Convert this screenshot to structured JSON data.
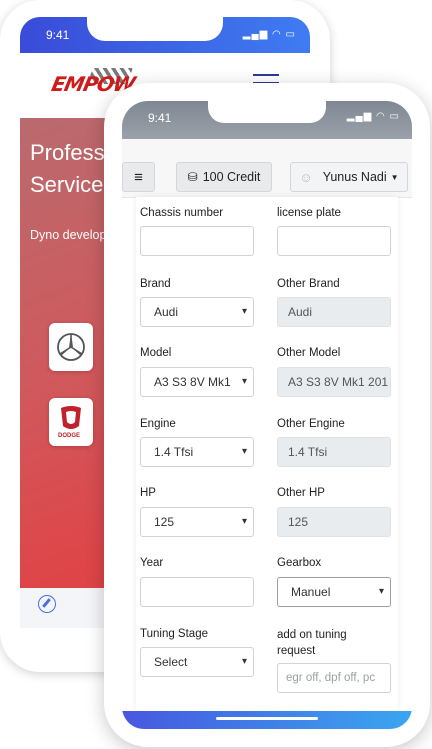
{
  "back_phone": {
    "time": "9:41",
    "logo": "EMPOW",
    "hero_title_line1": "Profess",
    "hero_title_line2": "Service",
    "hero_subtitle": "Dyno develop",
    "brand1_icon": "mercedes-logo-icon",
    "brand2_icon": "dodge-logo-icon",
    "brand2_text": "DODGE"
  },
  "front_phone": {
    "time": "9:41",
    "topbar": {
      "credit_label": "100 Credit",
      "user_name": "Yunus Nadi"
    },
    "form": {
      "chassis_label": "Chassis number",
      "chassis_value": "",
      "plate_label": "license plate",
      "plate_value": "",
      "brand_label": "Brand",
      "brand_value": "Audi",
      "other_brand_label": "Other Brand",
      "other_brand_value": "Audi",
      "model_label": "Model",
      "model_value": "A3 S3 8V Mk1",
      "other_model_label": "Other Model",
      "other_model_value": "A3 S3 8V Mk1 201",
      "engine_label": "Engine",
      "engine_value": "1.4 Tfsi",
      "other_engine_label": "Other Engine",
      "other_engine_value": "1.4 Tfsi",
      "hp_label": "HP",
      "hp_value": "125",
      "other_hp_label": "Other HP",
      "other_hp_value": "125",
      "year_label": "Year",
      "year_value": "",
      "gearbox_label": "Gearbox",
      "gearbox_value": "Manuel",
      "tuning_stage_label": "Tuning Stage",
      "tuning_stage_value": "Select",
      "addon_label_line1": "add on tuning",
      "addon_label_line2": "request",
      "addon_placeholder": "egr off, dpf off, pc"
    }
  },
  "colors": {
    "accent_blue": "#3f6fe8",
    "hero_red": "#e53b3f",
    "logo_red": "#d11a1a"
  }
}
